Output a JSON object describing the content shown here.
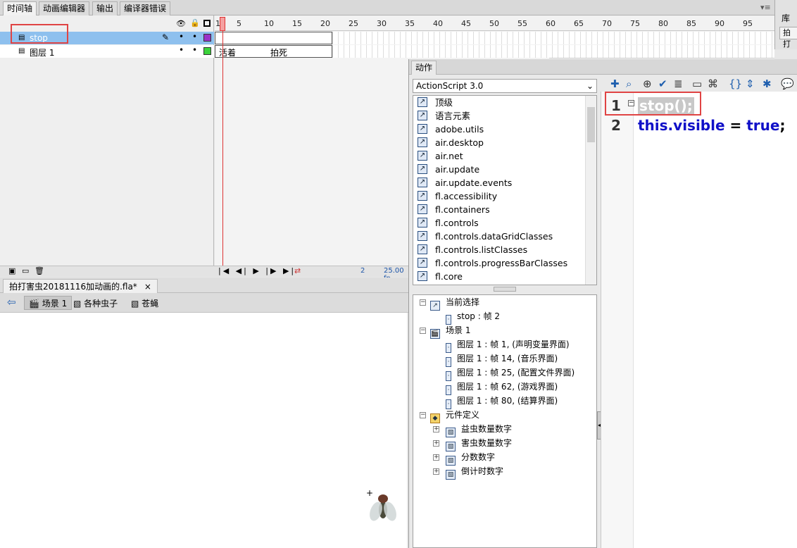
{
  "tabs": [
    "时间轴",
    "动画编辑器",
    "输出",
    "编译器错误"
  ],
  "library_tab": "库",
  "library_btn": "拍打",
  "layers": [
    {
      "name": "stop",
      "selected": true
    },
    {
      "name": "图层 1",
      "selected": false
    }
  ],
  "ruler": [
    "1",
    "5",
    "10",
    "15",
    "20",
    "25",
    "30",
    "35",
    "40",
    "45",
    "50",
    "55",
    "60",
    "65",
    "70",
    "75",
    "80",
    "85",
    "90",
    "95"
  ],
  "frame_labels": {
    "a": "活着",
    "b": "拍死"
  },
  "timeline_status": {
    "frame": "2",
    "fps": "25.00 fp"
  },
  "doc_tab": "拍打害虫20181116加动画的.fla*",
  "scene_nav": [
    "场景 1",
    "各种虫子",
    "苍蝇"
  ],
  "actions": {
    "title": "动作",
    "combo": "ActionScript 3.0",
    "packages": [
      "顶级",
      "语言元素",
      "adobe.utils",
      "air.desktop",
      "air.net",
      "air.update",
      "air.update.events",
      "fl.accessibility",
      "fl.containers",
      "fl.controls",
      "fl.controls.dataGridClasses",
      "fl.controls.listClasses",
      "fl.controls.progressBarClasses",
      "fl.core"
    ],
    "tree": [
      {
        "label": "当前选择",
        "level": 0
      },
      {
        "label": "stop : 帧 2",
        "level": 1
      },
      {
        "label": "场景 1",
        "level": 0
      },
      {
        "label": "图层 1 : 帧 1, (声明变量界面)",
        "level": 1
      },
      {
        "label": "图层 1 : 帧 14, (音乐界面)",
        "level": 1
      },
      {
        "label": "图层 1 : 帧 25, (配置文件界面)",
        "level": 1
      },
      {
        "label": "图层 1 : 帧 62, (游戏界面)",
        "level": 1
      },
      {
        "label": "图层 1 : 帧 80, (结算界面)",
        "level": 1
      },
      {
        "label": "元件定义",
        "level": 0
      },
      {
        "label": "益虫数量数字",
        "level": 1
      },
      {
        "label": "害虫数量数字",
        "level": 1
      },
      {
        "label": "分数数字",
        "level": 1
      },
      {
        "label": "倒计时数字",
        "level": 1
      }
    ],
    "code": {
      "line1_num": "1",
      "line2_num": "2",
      "line1": "stop();",
      "line2_kw1": "this.visible",
      "line2_eq": " = ",
      "line2_kw2": "true",
      ";": ";"
    }
  }
}
